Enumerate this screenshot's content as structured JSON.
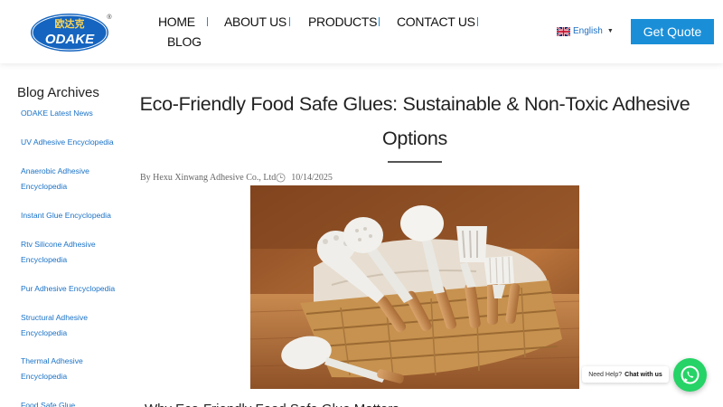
{
  "header": {
    "logo": {
      "brand_text": "ODAKE",
      "chinese_text": "欧达克",
      "registered_mark": "®"
    },
    "nav": [
      {
        "label": "HOME"
      },
      {
        "label": "ABOUT US"
      },
      {
        "label": "PRODUCTS"
      },
      {
        "label": "CONTACT US"
      },
      {
        "label": "BLOG"
      }
    ],
    "language": {
      "label": "English",
      "flag_icon": "uk-flag-icon"
    },
    "cta": {
      "label": "Get Quote"
    }
  },
  "sidebar": {
    "title": "Blog Archives",
    "items": [
      {
        "label": "ODAKE Latest News"
      },
      {
        "label": "UV Adhesive Encyclopedia"
      },
      {
        "label": "Anaerobic Adhesive Encyclopedia"
      },
      {
        "label": "Instant Glue Encyclopedia"
      },
      {
        "label": "Rtv Silicone Adhesive Encyclopedia"
      },
      {
        "label": "Pur Adhesive Encyclopedia"
      },
      {
        "label": "Structural Adhesive Encyclopedia"
      },
      {
        "label": "Thermal Adhesive Encyclopedia"
      },
      {
        "label": "Food Safe Glue"
      }
    ]
  },
  "article": {
    "title": "Eco-Friendly Food Safe Glues: Sustainable & Non-Toxic Adhesive Options",
    "author": "By Hexu Xinwang Adhesive Co., Ltd",
    "date": "10/14/2025",
    "next_heading": "Why Eco-Friendly Food Safe Glue Matters"
  },
  "chat": {
    "prefix": "Need Help?",
    "emphasis": "Chat with us",
    "icon": "whatsapp-icon"
  },
  "colors": {
    "accent": "#1a8fd8",
    "link": "#1a72c7",
    "whatsapp": "#25d366",
    "logo_blue": "#1565c0"
  }
}
